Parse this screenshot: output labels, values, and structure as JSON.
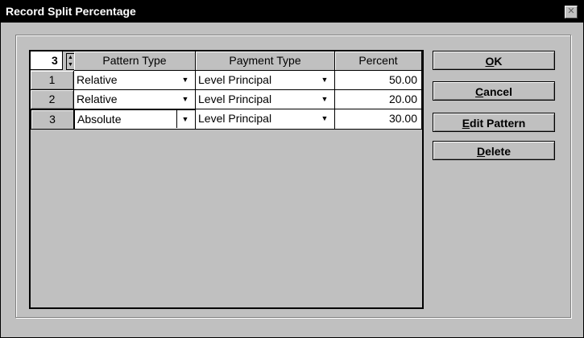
{
  "window": {
    "title": "Record Split Percentage",
    "close_glyph": "✕"
  },
  "grid": {
    "row_count": "3",
    "columns": [
      "Pattern Type",
      "Payment Type",
      "Percent"
    ],
    "rows": [
      {
        "num": "1",
        "pattern": "Relative",
        "payment": "Level Principal",
        "percent": "50.00"
      },
      {
        "num": "2",
        "pattern": "Relative",
        "payment": "Level Principal",
        "percent": "20.00"
      },
      {
        "num": "3",
        "pattern": "Absolute",
        "payment": "Level Principal",
        "percent": "30.00"
      }
    ],
    "dropdown_glyph": "▼",
    "spin_up": "▲",
    "spin_down": "▼"
  },
  "buttons": {
    "ok": {
      "mnemonic": "O",
      "rest": "K"
    },
    "cancel": {
      "mnemonic": "C",
      "rest": "ancel"
    },
    "edit_pattern": {
      "mnemonic": "E",
      "rest": "dit Pattern"
    },
    "delete": {
      "mnemonic": "D",
      "rest": "elete"
    }
  }
}
